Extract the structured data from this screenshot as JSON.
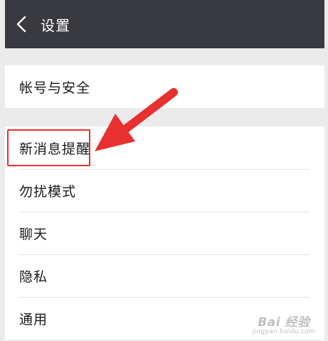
{
  "header": {
    "title": "设置",
    "back_icon": "chevron-left-icon"
  },
  "groups": [
    {
      "items": [
        {
          "label": "帐号与安全"
        }
      ]
    },
    {
      "items": [
        {
          "label": "新消息提醒"
        },
        {
          "label": "勿扰模式"
        },
        {
          "label": "聊天"
        },
        {
          "label": "隐私"
        },
        {
          "label": "通用"
        }
      ]
    }
  ],
  "annotation": {
    "color": "#e8302e"
  },
  "watermark": {
    "logo": "Bai 经验",
    "url": "jingyan.baidu.com"
  },
  "colors": {
    "title_bar": "#393a3f",
    "background": "#ebebeb",
    "item_background": "#ffffff"
  }
}
